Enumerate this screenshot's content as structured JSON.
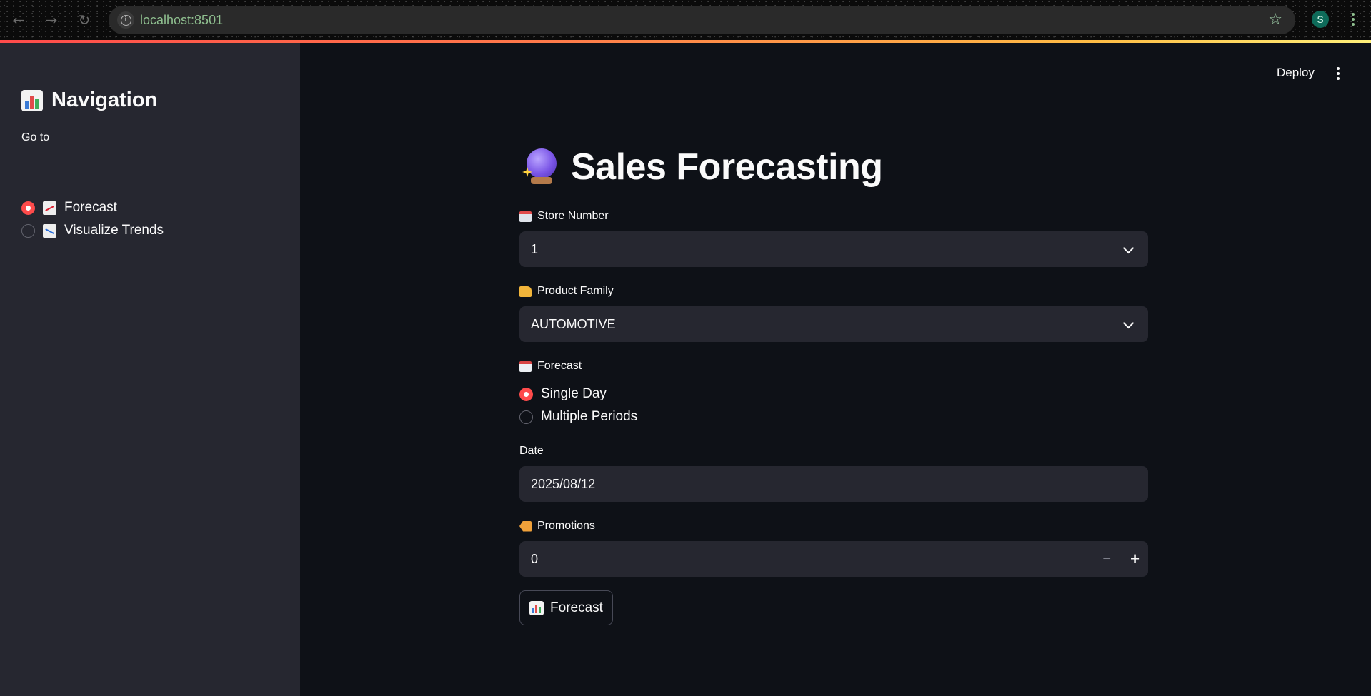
{
  "browser": {
    "url": "localhost:8501",
    "profile_initial": "S"
  },
  "sidebar": {
    "title": "Navigation",
    "goto_label": "Go to",
    "options": [
      {
        "label": "Forecast",
        "selected": true
      },
      {
        "label": "Visualize Trends",
        "selected": false
      }
    ]
  },
  "header": {
    "deploy_label": "Deploy"
  },
  "main": {
    "title": "Sales Forecasting",
    "store_number": {
      "label": "Store Number",
      "value": "1"
    },
    "product_family": {
      "label": "Product Family",
      "value": "AUTOMOTIVE"
    },
    "forecast": {
      "label": "Forecast",
      "options": [
        {
          "label": "Single Day",
          "selected": true
        },
        {
          "label": "Multiple Periods",
          "selected": false
        }
      ]
    },
    "date": {
      "label": "Date",
      "value": "2025/08/12"
    },
    "promotions": {
      "label": "Promotions",
      "value": "0",
      "minus": "−",
      "plus": "+"
    },
    "submit_label": "Forecast"
  },
  "colors": {
    "accent": "#ff4b4b",
    "background": "#0e1117",
    "sidebar": "#262730",
    "input": "#262730"
  }
}
